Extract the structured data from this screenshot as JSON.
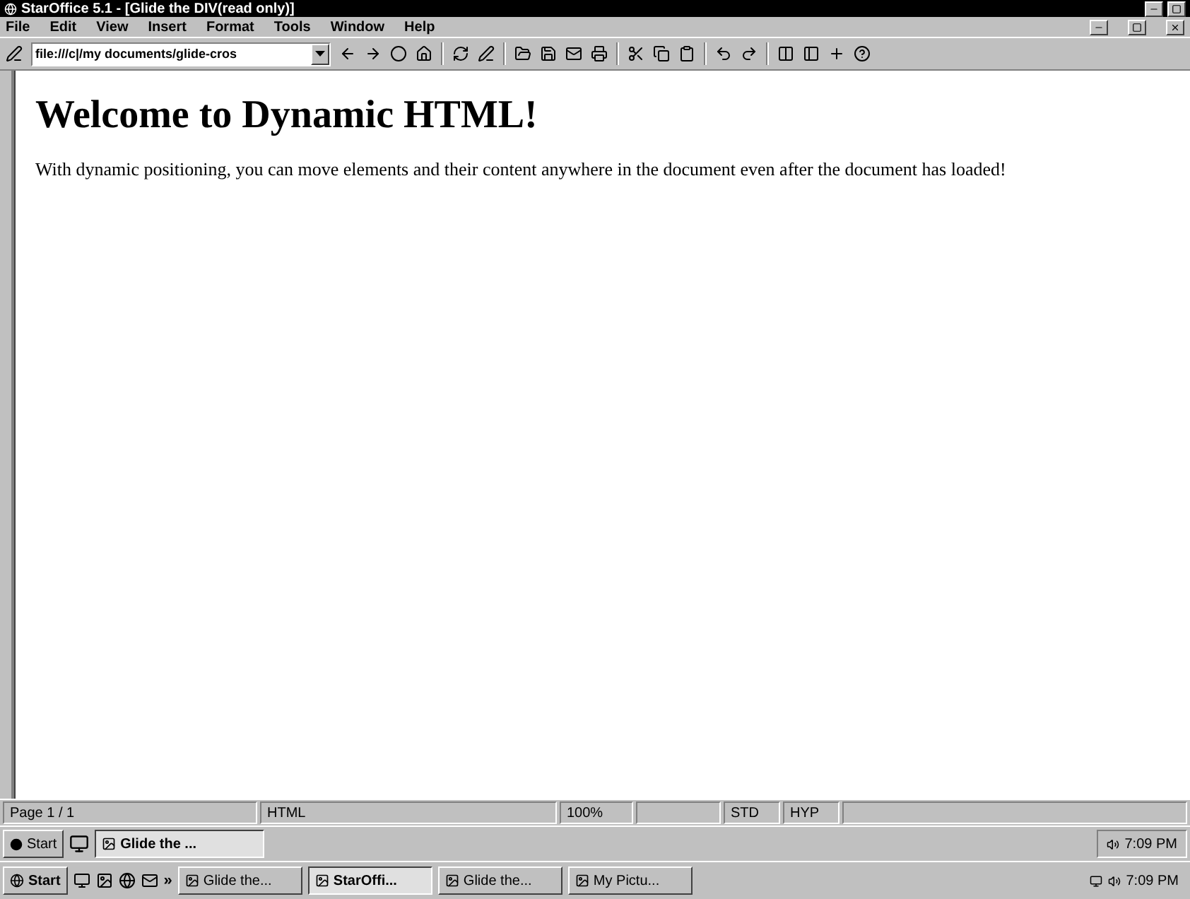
{
  "window": {
    "title": "StarOffice 5.1 - [Glide the DIV(read only)]"
  },
  "menu": [
    "File",
    "Edit",
    "View",
    "Insert",
    "Format",
    "Tools",
    "Window",
    "Help"
  ],
  "url_field": {
    "value": "file:///c|/my documents/glide-cros"
  },
  "document": {
    "heading": "Welcome to Dynamic HTML!",
    "paragraph": "With dynamic positioning, you can move elements and their content anywhere in the document even after the document has loaded!"
  },
  "status_bar": [
    "Page 1 / 1",
    "HTML",
    "100%",
    "STD",
    "HYP"
  ],
  "inner_taskbar": {
    "start": "Start",
    "tasks": [
      {
        "label": "Glide the ...",
        "selected": true
      }
    ],
    "clock": "7:09 PM"
  },
  "taskbar": {
    "start": "Start",
    "more": "»",
    "tasks": [
      {
        "label": "Glide the...",
        "selected": false
      },
      {
        "label": "StarOffi...",
        "selected": true
      },
      {
        "label": "Glide the...",
        "selected": false
      },
      {
        "label": "My Pictu...",
        "selected": false
      }
    ],
    "clock": "7:09 PM"
  }
}
